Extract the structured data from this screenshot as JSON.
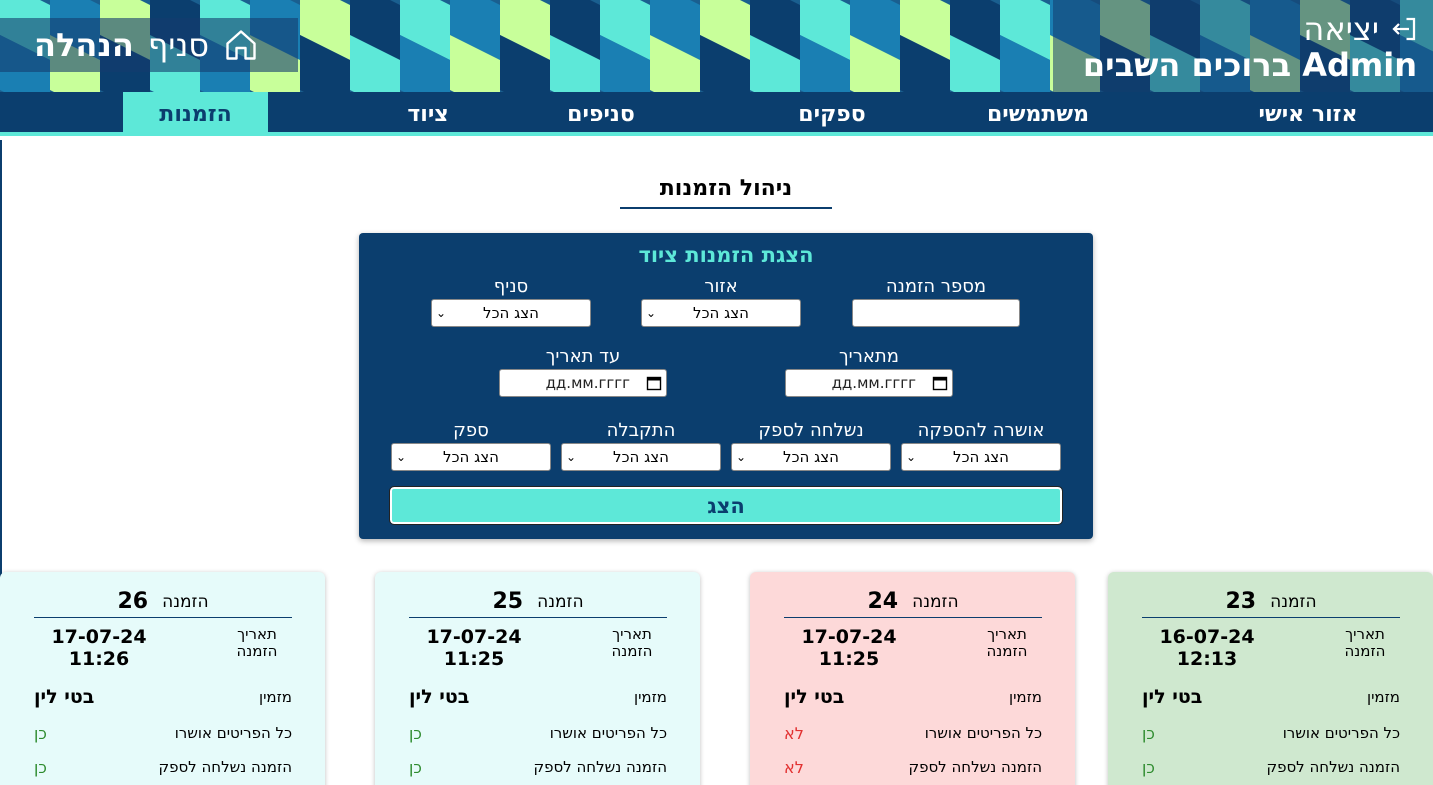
{
  "header": {
    "logout_label": "יציאה",
    "welcome": "Admin ברוכים השבים",
    "branch_word": "סניף",
    "branch_name": "הנהלה"
  },
  "nav": {
    "items": [
      {
        "label": "אזור אישי"
      },
      {
        "label": "משתמשים"
      },
      {
        "label": "ספקים"
      },
      {
        "label": "סניפים"
      },
      {
        "label": "ציוד"
      },
      {
        "label": "הזמנות"
      }
    ],
    "active": "הזמנות"
  },
  "page_title": "ניהול הזמנות",
  "filters": {
    "title": "הצגת הזמנות ציוד",
    "order_number_label": "מספר הזמנה",
    "area_label": "אזור",
    "area_value": "הצג הכל",
    "branch_label": "סניף",
    "branch_value": "הצג הכל",
    "from_date_label": "מתאריך",
    "from_date_placeholder": "дд.мм.гггг",
    "to_date_label": "עד תאריך",
    "to_date_placeholder": "дд.мм.гггг",
    "approved_label": "אושרה להספקה",
    "approved_value": "הצג הכל",
    "sent_label": "נשלחה לספק",
    "sent_value": "הצג הכל",
    "received_label": "התקבלה",
    "received_value": "הצג הכל",
    "supplier_label": "ספק",
    "supplier_value": "הצג הכל",
    "show_button": "הצג"
  },
  "card_labels": {
    "order": "הזמנה",
    "order_date": "תאריך הזמנה",
    "orderer": "מזמין",
    "all_approved": "כל הפריטים אושרו",
    "sent_to_supplier": "הזמנה נשלחה לספק"
  },
  "orders": [
    {
      "number": "23",
      "date": "16-07-24",
      "time": "12:13",
      "orderer": "בטי לין",
      "all_approved": "כן",
      "sent": "כן",
      "status_color": "#cfe8cf"
    },
    {
      "number": "24",
      "date": "17-07-24",
      "time": "11:25",
      "orderer": "בטי לין",
      "all_approved": "לא",
      "sent": "לא",
      "status_color": "#fdd9d9"
    },
    {
      "number": "25",
      "date": "17-07-24",
      "time": "11:25",
      "orderer": "בטי לין",
      "all_approved": "כן",
      "sent": "כן",
      "status_color": "#e6fbfa"
    },
    {
      "number": "26",
      "date": "17-07-24",
      "time": "11:26",
      "orderer": "בטי לין",
      "all_approved": "כן",
      "sent": "כן",
      "status_color": "#e6fbfa"
    }
  ],
  "colors": {
    "primary": "#0b3e6e",
    "accent": "#5de8d8",
    "yes": "#2e8b2e",
    "no": "#e23030"
  }
}
